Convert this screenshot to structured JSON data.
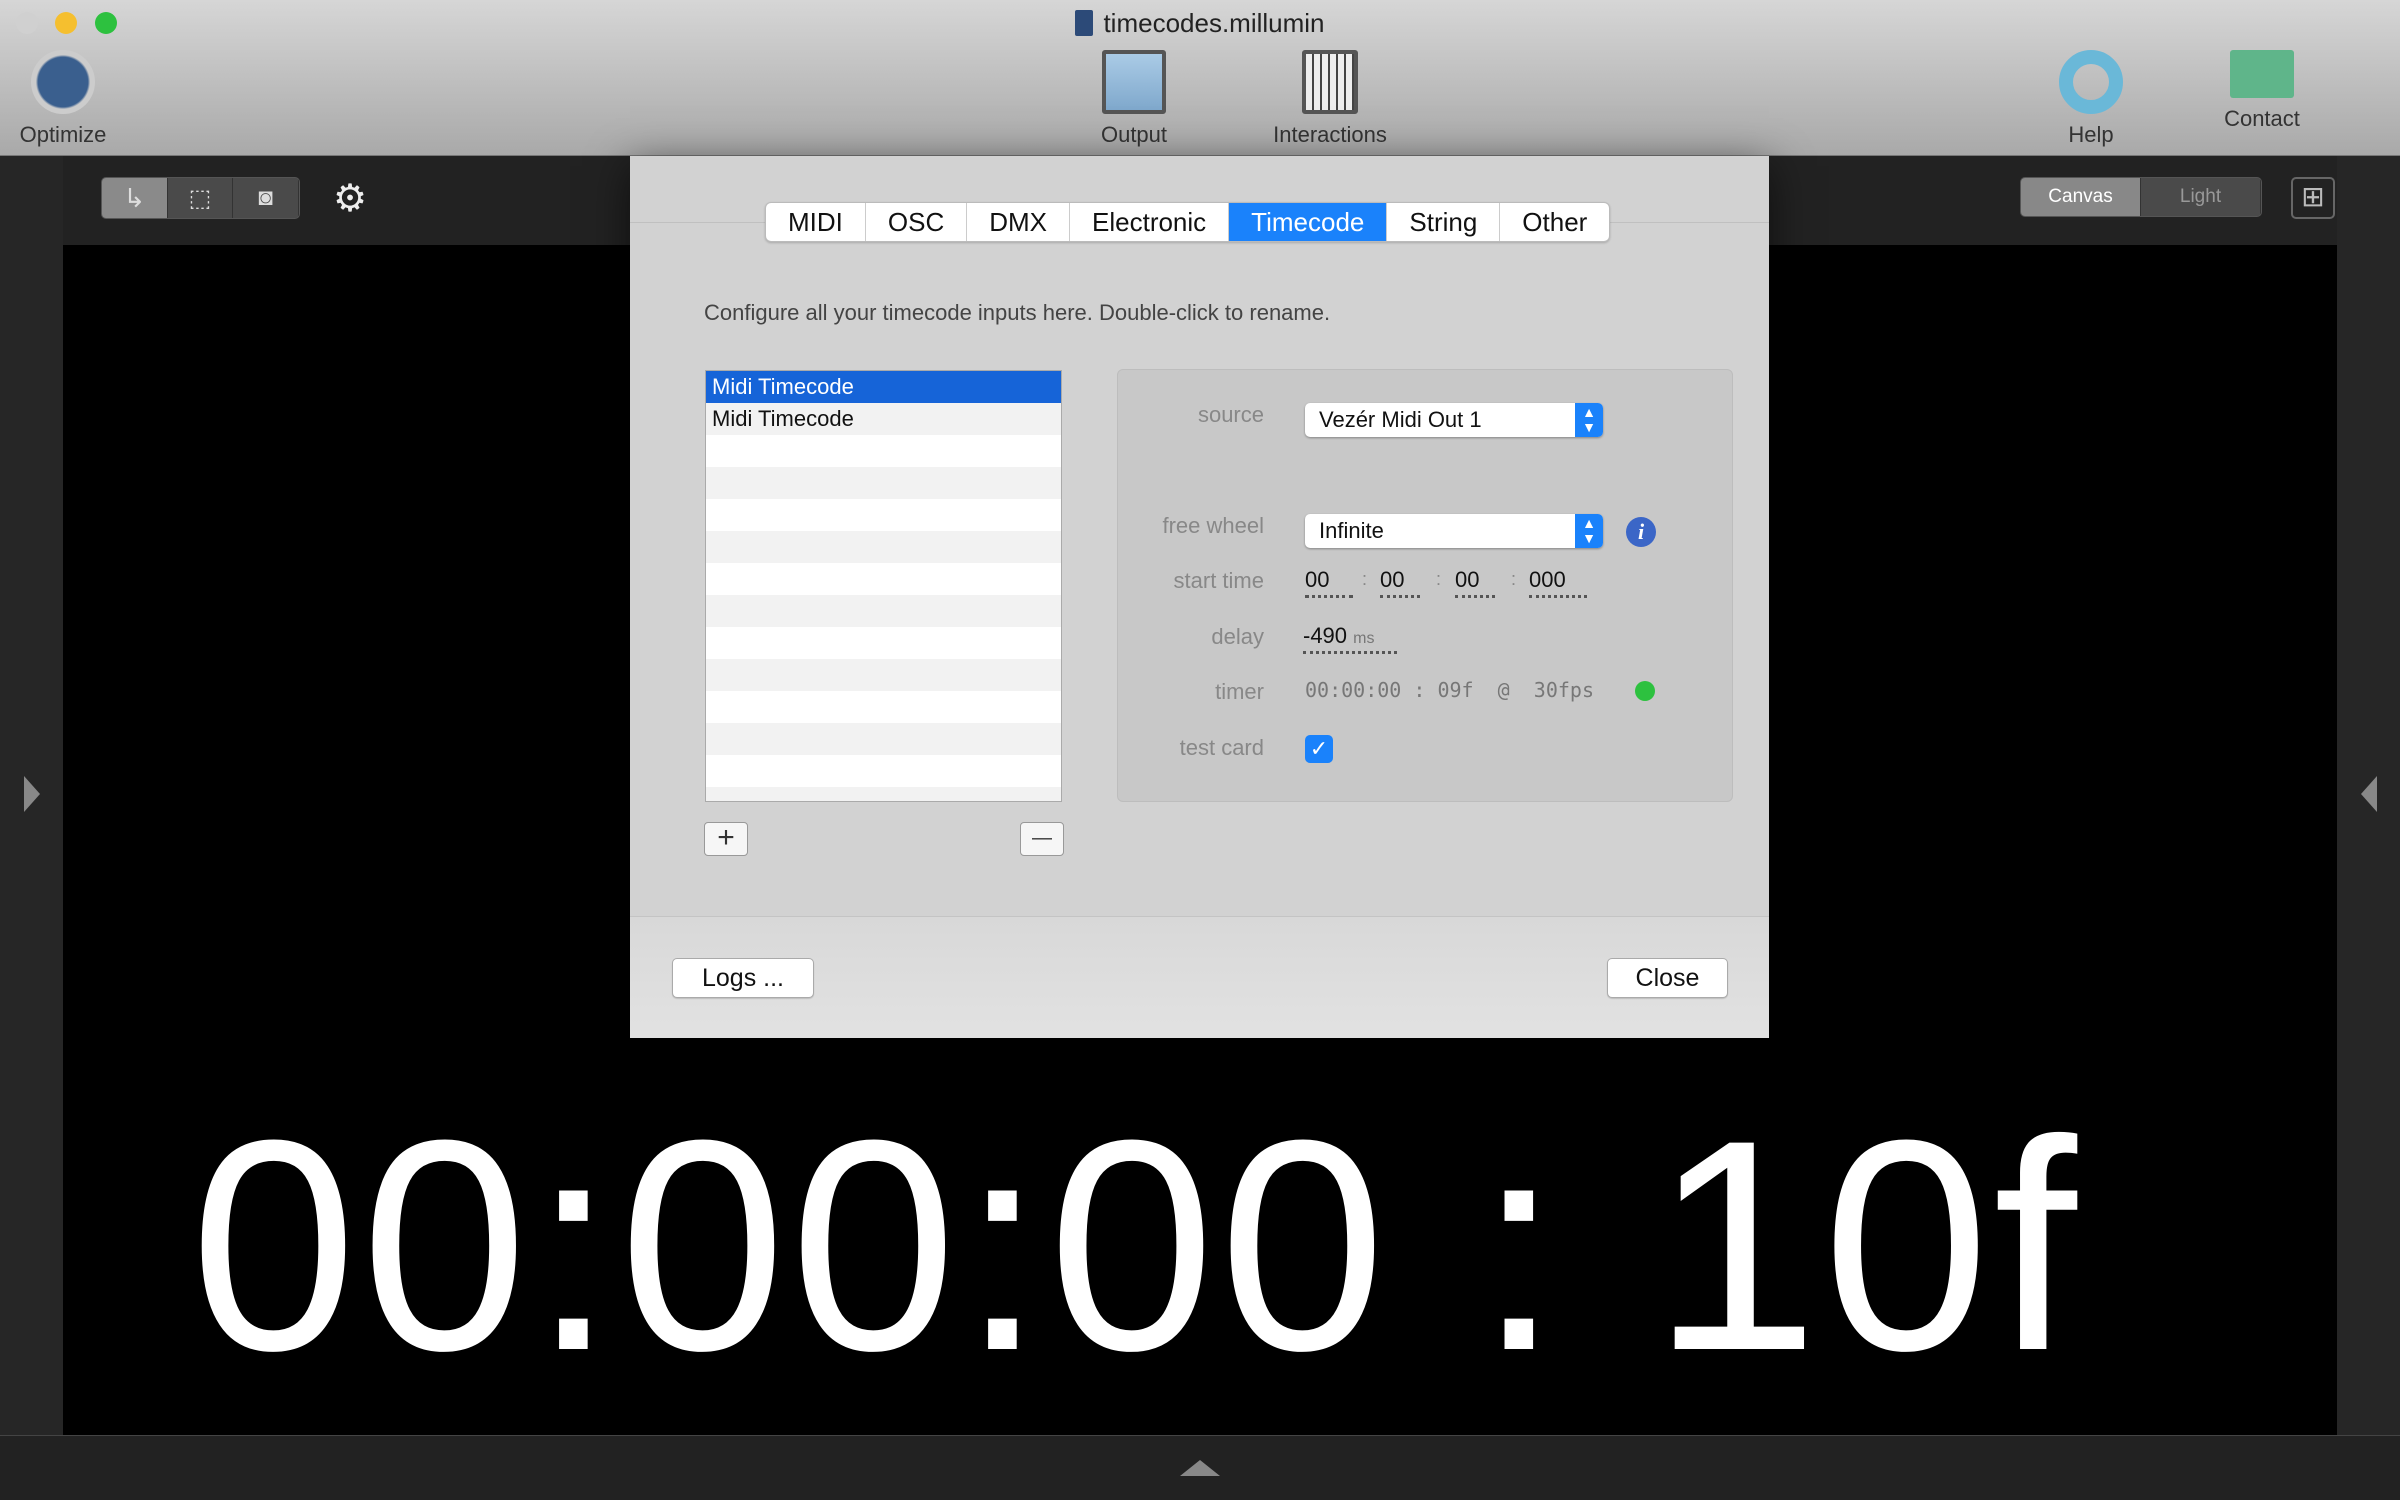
{
  "window": {
    "title": "timecodes.millumin"
  },
  "toolbar": {
    "optimize": "Optimize",
    "output": "Output",
    "interactions": "Interactions",
    "help": "Help",
    "contact": "Contact"
  },
  "canvas_toggle": {
    "canvas": "Canvas",
    "light": "Light"
  },
  "dialog": {
    "tabs": [
      "MIDI",
      "OSC",
      "DMX",
      "Electronic",
      "Timecode",
      "String",
      "Other"
    ],
    "active_tab": "Timecode",
    "hint": "Configure all your timecode inputs here. Double-click to rename.",
    "inputs": [
      "Midi Timecode",
      "Midi Timecode"
    ],
    "add": "+",
    "remove": "—",
    "labels": {
      "source": "source",
      "free_wheel": "free wheel",
      "start_time": "start time",
      "delay": "delay",
      "timer": "timer",
      "test_card": "test card"
    },
    "source": "Vezér Midi Out 1",
    "free_wheel": "Infinite",
    "start_time": {
      "h": "00",
      "m": "00",
      "s": "00",
      "ms": "000",
      "sep": ":"
    },
    "delay": {
      "value": "-490",
      "unit": "ms"
    },
    "timer": "00:00:00 : 09f  @  30fps",
    "test_card_checked": true,
    "logs": "Logs ...",
    "close": "Close"
  },
  "canvas_timecode": "00:00:00 : 10f"
}
